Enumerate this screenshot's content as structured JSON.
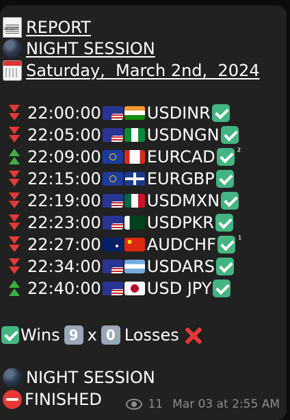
{
  "header": {
    "report": {
      "icon": "receipt-icon",
      "label": "REPORT"
    },
    "session": {
      "icon": "globe-icon",
      "label": "NIGHT SESSION"
    },
    "date": {
      "icon": "calendar-icon",
      "label": "Saturday,  March 2nd,  2024"
    }
  },
  "trades": [
    {
      "direction": "down",
      "time": "22:00:00",
      "flags": [
        "us",
        "in"
      ],
      "pair": "USDINR",
      "result": "check-icon",
      "note": ""
    },
    {
      "direction": "down",
      "time": "22:05:00",
      "flags": [
        "us",
        "ng"
      ],
      "pair": "USDNGN",
      "result": "check-icon",
      "note": ""
    },
    {
      "direction": "up",
      "time": "22:09:00",
      "flags": [
        "eu",
        "ca"
      ],
      "pair": "EURCAD",
      "result": "check-icon",
      "note": "²"
    },
    {
      "direction": "down",
      "time": "22:15:00",
      "flags": [
        "eu",
        "gb"
      ],
      "pair": "EURGBP",
      "result": "check-icon",
      "note": ""
    },
    {
      "direction": "down",
      "time": "22:19:00",
      "flags": [
        "us",
        "mx"
      ],
      "pair": "USDMXN",
      "result": "check-icon",
      "note": ""
    },
    {
      "direction": "down",
      "time": "22:23:00",
      "flags": [
        "us",
        "pk"
      ],
      "pair": "USDPKR",
      "result": "check-icon",
      "note": ""
    },
    {
      "direction": "down",
      "time": "22:27:00",
      "flags": [
        "au",
        "cn"
      ],
      "pair": "AUDCHF",
      "result": "check-icon",
      "note": "¹"
    },
    {
      "direction": "down",
      "time": "22:34:00",
      "flags": [
        "us",
        "ar"
      ],
      "pair": "USDARS",
      "result": "check-icon",
      "note": ""
    },
    {
      "direction": "up",
      "time": "22:40:00",
      "flags": [
        "us",
        "jp"
      ],
      "pair": "USD JPY",
      "result": "check-icon",
      "note": ""
    }
  ],
  "summary": {
    "wins_label": "Wins",
    "wins_count": "9",
    "times": "x",
    "losses_count": "0",
    "losses_label": "Losses"
  },
  "footer": {
    "session_label": "NIGHT SESSION",
    "finished_label": "FINISHED"
  },
  "meta": {
    "views": "11",
    "timestamp": "Mar 03 at 2:55 AM"
  },
  "colors": {
    "bubble": "#212121",
    "background": "#0c0c0c",
    "down_arrow": "#e53935",
    "up_arrow": "#3cb043",
    "check": "#43b581",
    "meta_text": "#8d8d8d"
  }
}
